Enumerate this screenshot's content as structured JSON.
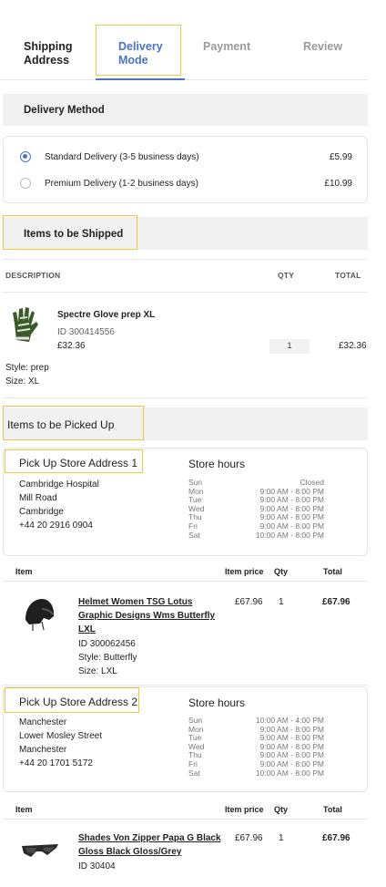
{
  "steps": [
    {
      "label_1": "Shipping",
      "label_2": "Address"
    },
    {
      "label_1": "Delivery",
      "label_2": "Mode"
    },
    {
      "label": "Payment"
    },
    {
      "label": "Review"
    }
  ],
  "delivery": {
    "title": "Delivery Method",
    "options": [
      {
        "label": "Standard Delivery (3-5 business days)",
        "price": "£5.99",
        "selected": true
      },
      {
        "label": "Premium Delivery (1-2 business days)",
        "price": "£10.99",
        "selected": false
      }
    ]
  },
  "shipped": {
    "title": "Items to be Shipped",
    "headers": {
      "description": "DESCRIPTION",
      "qty": "QTY",
      "total": "TOTAL"
    },
    "item": {
      "name": "Spectre Glove prep XL",
      "id": "ID 300414556",
      "price": "£32.36",
      "qty": "1",
      "total": "£32.36",
      "style": "Style: prep",
      "size": "Size: XL"
    }
  },
  "pickup": {
    "title": "Items to be Picked Up",
    "table_headers": {
      "item": "Item",
      "item_price": "Item price",
      "qty": "Qty",
      "total": "Total"
    },
    "hours_title": "Store hours",
    "days": [
      "Sun",
      "Mon",
      "Tue",
      "Wed",
      "Thu",
      "Fri",
      "Sat"
    ],
    "stores": [
      {
        "title": "Pick Up Store Address 1",
        "address": [
          "Cambridge Hospital",
          "Mill Road",
          "Cambridge",
          "+44 20 2916 0904"
        ],
        "hours": [
          "Closed",
          "9:00 AM - 8:00 PM",
          "9:00 AM - 8:00 PM",
          "9:00 AM - 8:00 PM",
          "9:00 AM - 8:00 PM",
          "9:00 AM - 8:00 PM",
          "10:00 AM - 8:00 PM"
        ],
        "item": {
          "name_lines": [
            "Helmet Women TSG Lotus",
            "Graphic Designs Wms Butterfly",
            "LXL"
          ],
          "id": "ID 300062456",
          "style": "Style: Butterfly",
          "size": "Size: LXL",
          "price": "£67.96",
          "qty": "1",
          "total": "£67.96"
        }
      },
      {
        "title": "Pick Up Store Address 2",
        "address": [
          "Manchester",
          "Lower Mosley Street",
          "Manchester",
          "+44 20 1701 5172"
        ],
        "hours": [
          "10:00 AM - 4:00 PM",
          "9:00 AM - 8:00 PM",
          "9:00 AM - 8:00 PM",
          "9:00 AM - 8:00 PM",
          "9:00 AM - 8:00 PM",
          "9:00 AM - 8:00 PM",
          "10:00 AM - 8:00 PM"
        ],
        "item": {
          "name_lines": [
            "Shades Von Zipper Papa G Black",
            "Gloss Black Gloss/Grey"
          ],
          "id": "ID 30404",
          "price": "£67.96",
          "qty": "1",
          "total": "£67.96"
        }
      }
    ]
  },
  "colors": {
    "accent": "#4a73c5",
    "highlight": "#f3c53f",
    "panel": "#f1f1f1"
  }
}
